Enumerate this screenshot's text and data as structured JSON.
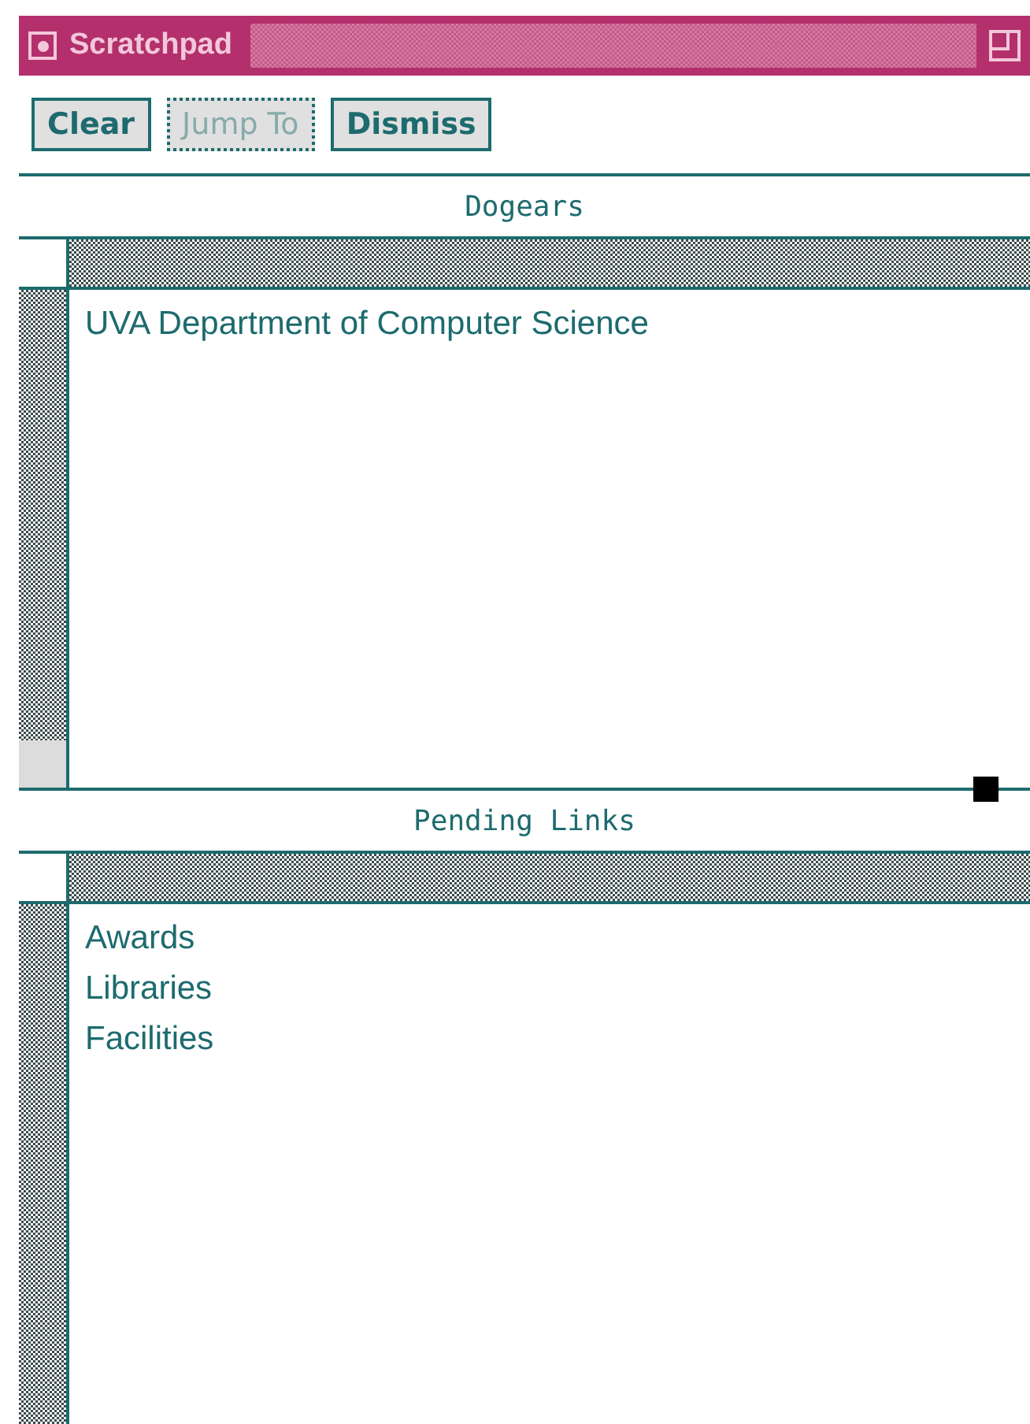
{
  "window": {
    "title": "Scratchpad"
  },
  "buttons": [
    {
      "label": "Clear",
      "disabled": false
    },
    {
      "label": "Jump To",
      "disabled": true
    },
    {
      "label": "Dismiss",
      "disabled": false
    }
  ],
  "panes": [
    {
      "title": "Dogears",
      "items": [
        "UVA Department of Computer Science"
      ]
    },
    {
      "title": "Pending Links",
      "items": [
        "Awards",
        "Libraries",
        "Facilities"
      ]
    }
  ]
}
